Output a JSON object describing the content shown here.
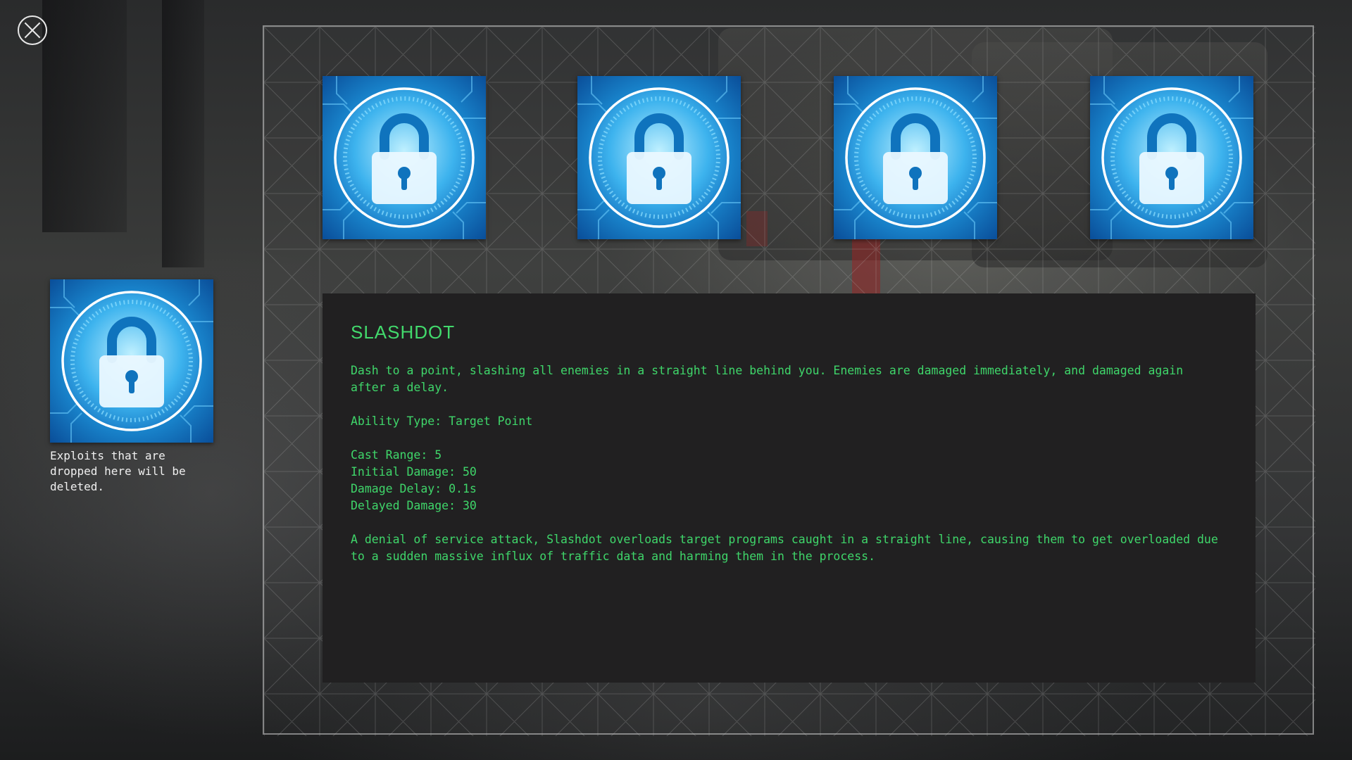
{
  "close_button": {
    "icon": "close-icon"
  },
  "exploits": [
    {
      "name": "Slashdot",
      "icon": "lock-icon"
    },
    {
      "name": "Slashdot",
      "icon": "lock-icon"
    },
    {
      "name": "Slashdot",
      "icon": "lock-icon"
    },
    {
      "name": "Slashdot",
      "icon": "lock-icon"
    }
  ],
  "trash": {
    "icon": "lock-icon",
    "text": "Exploits that are\ndropped here will be\ndeleted."
  },
  "info": {
    "title": "SLASHDOT",
    "lines": [
      "Dash to a point, slashing all enemies in a straight line behind you. Enemies are damaged immediately, and damaged again",
      "after a delay.",
      "",
      "Ability Type: Target Point",
      "",
      "Cast Range: 5",
      "Initial Damage: 50",
      "Damage Delay: 0.1s",
      "Delayed Damage: 30",
      "",
      "A denial of service attack, Slashdot overloads target programs caught in a straight line, causing them to get overloaded due",
      "to a sudden massive influx of traffic data and harming them in the process."
    ]
  },
  "colors": {
    "text_green": "#3fd66a",
    "panel_bg": "#212021",
    "icon_blue": "#1a8fd8"
  }
}
